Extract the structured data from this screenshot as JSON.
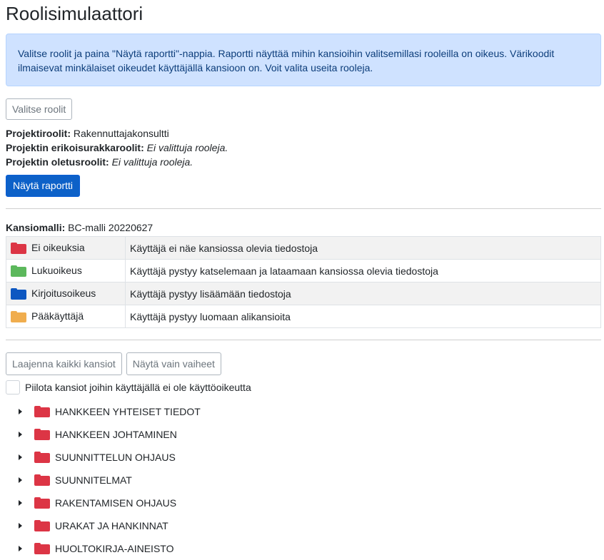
{
  "title": "Roolisimulaattori",
  "info_text": "Valitse roolit ja paina \"Näytä raportti\"-nappia. Raportti näyttää mihin kansioihin valitsemillasi rooleilla on oikeus. Värikoodit ilmaisevat minkälaiset oikeudet käyttäjällä kansioon on. Voit valita useita rooleja.",
  "select_roles_label": "Valitse roolit",
  "roles": {
    "project_label": "Projektiroolit:",
    "project_value": "Rakennuttajakonsultti",
    "special_label": "Projektin erikoisurakkaroolit:",
    "special_value": "Ei valittuja rooleja.",
    "default_label": "Projektin oletusroolit:",
    "default_value": "Ei valittuja rooleja."
  },
  "show_report_label": "Näytä raportti",
  "model": {
    "label": "Kansiomalli:",
    "value": "BC-malli 20220627"
  },
  "legend": [
    {
      "name": "Ei oikeuksia",
      "desc": "Käyttäjä ei näe kansiossa olevia tiedostoja",
      "color": "#dc3545"
    },
    {
      "name": "Lukuoikeus",
      "desc": "Käyttäjä pystyy katselemaan ja lataamaan kansiossa olevia tiedostoja",
      "color": "#5cb85c"
    },
    {
      "name": "Kirjoitusoikeus",
      "desc": "Käyttäjä pystyy lisäämään tiedostoja",
      "color": "#0d57c1"
    },
    {
      "name": "Pääkäyttäjä",
      "desc": "Käyttäjä pystyy luomaan alikansioita",
      "color": "#f0ad4e"
    }
  ],
  "expand_all_label": "Laajenna kaikki kansiot",
  "show_phases_label": "Näytä vain vaiheet",
  "hide_folders_label": "Piilota kansiot joihin käyttäjällä ei ole käyttöoikeutta",
  "folders": [
    "HANKKEEN YHTEISET TIEDOT",
    "HANKKEEN JOHTAMINEN",
    "SUUNNITTELUN OHJAUS",
    "SUUNNITELMAT",
    "RAKENTAMISEN OHJAUS",
    "URAKAT JA HANKINNAT",
    "HUOLTOKIRJA-AINEISTO"
  ],
  "folder_color": "#dc3545"
}
